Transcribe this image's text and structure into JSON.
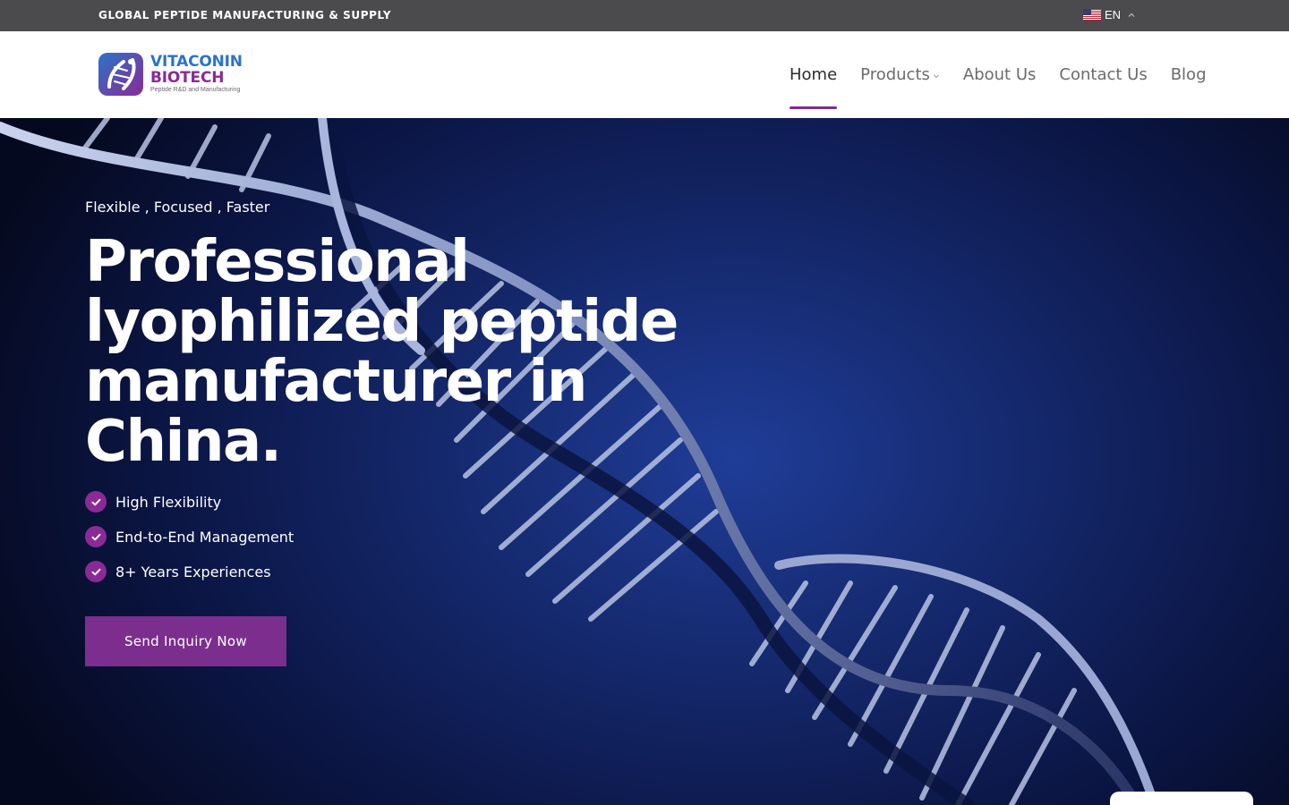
{
  "topbar": {
    "text": "GLOBAL PEPTIDE MANUFACTURING & SUPPLY",
    "language": "EN",
    "flag_icon": "us-flag-icon"
  },
  "logo": {
    "line1": "VITACONIN",
    "line2": "BIOTECH",
    "line3": "Peptide R&D and Manufacturing"
  },
  "nav": {
    "items": [
      {
        "label": "Home",
        "active": true
      },
      {
        "label": "Products",
        "has_dropdown": true
      },
      {
        "label": "About Us"
      },
      {
        "label": "Contact Us"
      },
      {
        "label": "Blog"
      }
    ]
  },
  "hero": {
    "tagline": "Flexible , Focused , Faster",
    "title": "Professional lyophilized peptide manufacturer in China.",
    "features": [
      "High Flexibility",
      "End-to-End Management",
      "8+ Years Experiences"
    ],
    "cta_label": "Send Inquiry Now"
  },
  "colors": {
    "brand_purple": "#7c2e8e",
    "brand_blue": "#2a74c7",
    "topbar_bg": "#4b4b4d",
    "hero_bg": "#15296e"
  }
}
